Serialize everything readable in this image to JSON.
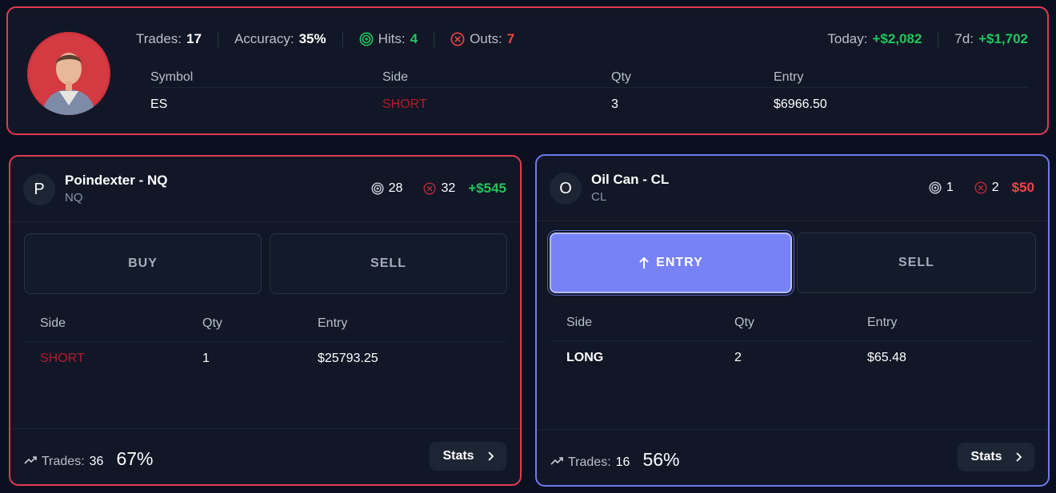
{
  "summary": {
    "trades_label": "Trades:",
    "trades": "17",
    "accuracy_label": "Accuracy:",
    "accuracy": "35%",
    "hits_label": "Hits:",
    "hits": "4",
    "outs_label": "Outs:",
    "outs": "7",
    "today_label": "Today:",
    "today": "+$2,082",
    "week_label": "7d:",
    "week": "+$1,702",
    "table": {
      "headers": [
        "Symbol",
        "Side",
        "Qty",
        "Entry"
      ],
      "row": [
        "ES",
        "SHORT",
        "3",
        "$6966.50"
      ]
    }
  },
  "bots": [
    {
      "letter": "P",
      "title": "Poindexter - NQ",
      "symbol": "NQ",
      "hits": "28",
      "outs": "32",
      "pnl": "+$545",
      "buttons": [
        "BUY",
        "SELL"
      ],
      "table": {
        "headers": [
          "Side",
          "Qty",
          "Entry"
        ],
        "row": [
          "SHORT",
          "1",
          "$25793.25"
        ]
      },
      "trades_label": "Trades:",
      "trades": "36",
      "accuracy": "67%",
      "stats_label": "Stats"
    },
    {
      "letter": "O",
      "title": "Oil Can - CL",
      "symbol": "CL",
      "hits": "1",
      "outs": "2",
      "pnl": "$50",
      "buttons": [
        "ENTRY",
        "SELL"
      ],
      "table": {
        "headers": [
          "Side",
          "Qty",
          "Entry"
        ],
        "row": [
          "LONG",
          "2",
          "$65.48"
        ]
      },
      "trades_label": "Trades:",
      "trades": "16",
      "accuracy": "56%",
      "stats_label": "Stats"
    }
  ],
  "colors": {
    "accent_red": "#e23a52",
    "accent_blue": "#6f79ee",
    "positive": "#22c55e",
    "negative": "#ef4444"
  },
  "icons": [
    "target-icon",
    "x-circle-icon",
    "trend-up-icon",
    "chevron-right-icon",
    "arrow-up-icon"
  ]
}
